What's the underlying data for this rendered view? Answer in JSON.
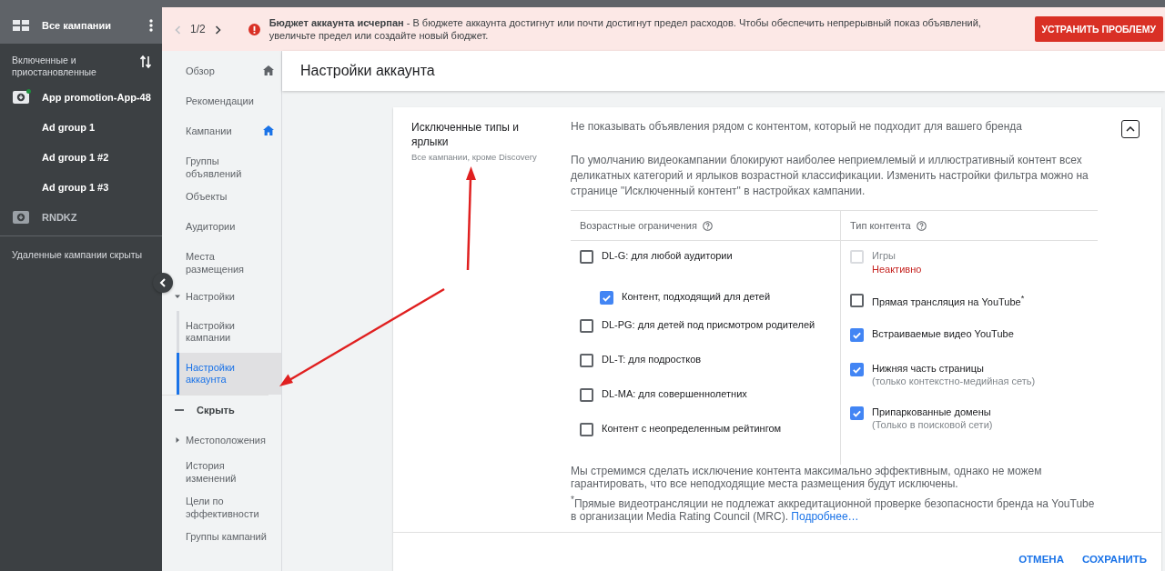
{
  "sidebar": {
    "title": "Все кампании",
    "filter_label": "Включенные и приостановленные",
    "campaigns": [
      {
        "name": "App promotion-App-48",
        "enabled": true,
        "children": [
          {
            "name": "Ad group 1"
          },
          {
            "name": "Ad group 1 #2"
          },
          {
            "name": "Ad group 1 #3"
          }
        ]
      },
      {
        "name": "RNDKZ",
        "enabled": false
      }
    ],
    "footer": "Удаленные кампании скрыты"
  },
  "alert": {
    "pager": "1/2",
    "title": "Бюджет аккаунта исчерпан",
    "text": " - В бюджете аккаунта достигнут или почти достигнут предел расходов. Чтобы обеспечить непрерывный показ объявлений, увеличьте предел или создайте новый бюджет.",
    "action": "УСТРАНИТЬ ПРОБЛЕМУ"
  },
  "nav": [
    {
      "kind": "link",
      "label": "Обзор",
      "pinned": true,
      "current": false,
      "selected": false
    },
    {
      "kind": "link",
      "label": "Рекомендации",
      "pinned": false,
      "selected": false
    },
    {
      "kind": "link",
      "label": "Кампании",
      "pinned": true,
      "current": true,
      "selected": false
    },
    {
      "kind": "link",
      "label": "Группы объявлений",
      "pinned": false,
      "selected": false
    },
    {
      "kind": "link",
      "label": "Объекты",
      "pinned": false,
      "selected": false
    },
    {
      "kind": "link",
      "label": "Аудитории",
      "pinned": false,
      "selected": false
    },
    {
      "kind": "link",
      "label": "Места размещения",
      "pinned": false,
      "selected": false
    },
    {
      "kind": "section",
      "label": "Настройки",
      "expanded": true,
      "children": [
        {
          "label": "Настройки кампании",
          "selected": false
        },
        {
          "label": "Настройки аккаунта",
          "selected": true
        }
      ]
    },
    {
      "kind": "toggle",
      "label": "Скрыть"
    },
    {
      "kind": "section",
      "label": "Местоположения",
      "expanded": false
    },
    {
      "kind": "link",
      "label": "История изменений",
      "pinned": false,
      "selected": false
    },
    {
      "kind": "link",
      "label": "Цели по эффективности",
      "pinned": false,
      "selected": false
    },
    {
      "kind": "link",
      "label": "Группы кампаний",
      "pinned": false,
      "selected": false
    }
  ],
  "page_title": "Настройки аккаунта",
  "card": {
    "title": "Исключенные типы и ярлыки",
    "subtitle": "Все кампании, кроме Discovery",
    "expanded": true,
    "lead": "Не показывать объявления рядом с контентом, который не подходит для вашего бренда",
    "description": "По умолчанию видеокампании блокируют наиболее неприемлемый и иллюстративный контент всех деликатных категорий и ярлыков возрастной классификации. Изменить настройки фильтра можно на странице \"Исключенный контент\" в настройках кампании.",
    "columns": [
      {
        "heading": "Возрастные ограничения",
        "options": [
          {
            "label": "DL-G: для любой аудитории",
            "checked": false,
            "disabled": false,
            "children": [
              {
                "label": "Контент, подходящий для детей",
                "checked": true,
                "disabled": false
              }
            ]
          },
          {
            "label": "DL-PG: для детей под присмотром родителей",
            "checked": false,
            "disabled": false
          },
          {
            "label": "DL-T: для подростков",
            "checked": false,
            "disabled": false
          },
          {
            "label": "DL-MA: для совершеннолетних",
            "checked": false,
            "disabled": false
          },
          {
            "label": "Контент с неопределенным рейтингом",
            "checked": false,
            "disabled": false
          }
        ]
      },
      {
        "heading": "Тип контента",
        "options": [
          {
            "label": "Игры",
            "checked": false,
            "disabled": true,
            "status": "Неактивно"
          },
          {
            "label": "Прямая трансляция на YouTube$^{*}$",
            "checked": false,
            "disabled": false
          },
          {
            "label": "Встраиваемые видео YouTube",
            "checked": true,
            "disabled": false
          },
          {
            "label": "Нижняя часть страницы",
            "checked": true,
            "disabled": false,
            "note": "(только контекстно-медийная сеть)"
          },
          {
            "label": "Припаркованные домены",
            "checked": true,
            "disabled": false,
            "note": "(Только в поисковой сети)"
          }
        ]
      }
    ],
    "disclaimer": "Мы стремимся сделать исключение контента максимально эффективным, однако не можем гарантировать, что все неподходящие места размещения будут исключены.",
    "footnote": "$^{*}$Прямые видеотрансляции не подлежат аккредитационной проверке безопасности бренда на YouTube в организации Media Rating Council (MRC).",
    "link": "Подробнее…",
    "buttons": [
      {
        "label": "ОТМЕНА"
      },
      {
        "label": "СОХРАНИТЬ"
      }
    ]
  }
}
